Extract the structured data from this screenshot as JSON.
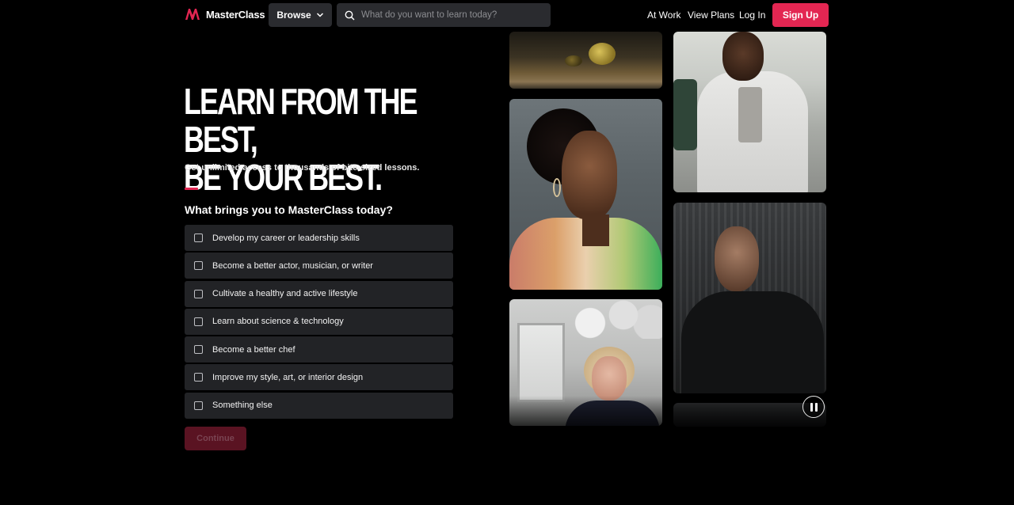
{
  "header": {
    "logo_text": "MasterClass",
    "browse_label": "Browse",
    "search_placeholder": "What do you want to learn today?",
    "nav": {
      "at_work": "At Work",
      "view_plans": "View Plans",
      "log_in": "Log In"
    },
    "signup_label": "Sign Up"
  },
  "hero": {
    "title_line1": "LEARN FROM THE BEST,",
    "title_line2": "BE YOUR BEST.",
    "subtitle": "Get unlimited access to thousands of bite-sized lessons."
  },
  "survey": {
    "question": "What brings you to MasterClass today?",
    "options": [
      {
        "label": "Develop my career or leadership skills",
        "checked": false
      },
      {
        "label": "Become a better actor, musician, or writer",
        "checked": false
      },
      {
        "label": "Cultivate a healthy and active lifestyle",
        "checked": false
      },
      {
        "label": "Learn about science & technology",
        "checked": false
      },
      {
        "label": "Become a better chef",
        "checked": false
      },
      {
        "label": "Improve my style, art, or interior design",
        "checked": false
      },
      {
        "label": "Something else",
        "checked": false
      }
    ],
    "continue_label": "Continue"
  },
  "media": {
    "icons": {
      "pause": "pause-icon",
      "search": "search-icon",
      "chevron": "chevron-down-icon",
      "logo": "masterclass-logo-icon"
    }
  },
  "colors": {
    "accent": "#e32652",
    "background": "#000000",
    "option_bg": "#222326",
    "continue_disabled_bg": "#5a1322"
  }
}
